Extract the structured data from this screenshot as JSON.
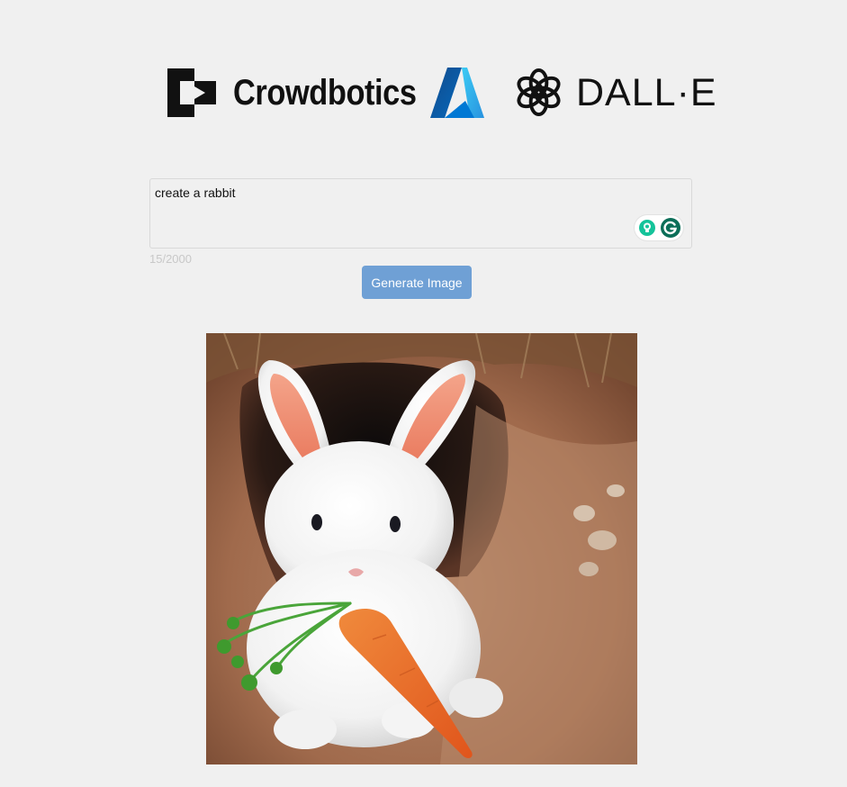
{
  "header": {
    "logos": [
      {
        "name": "crowdbotics-logo",
        "text": "Crowdbotics"
      },
      {
        "name": "azure-logo",
        "text": ""
      },
      {
        "name": "openai-logo",
        "text": "DALL·E"
      }
    ]
  },
  "prompt": {
    "value": "create a rabbit",
    "placeholder": "",
    "char_count": "15/2000"
  },
  "actions": {
    "generate_label": "Generate Image"
  },
  "result": {
    "alt": "Generated image"
  },
  "icons": {
    "grammarly_suggestion": "lightbulb-icon",
    "grammarly": "grammarly-icon"
  },
  "colors": {
    "background": "#f0f0f0",
    "button": "#6fa0d5",
    "grammarly_green": "#15c39a",
    "grammarly_dark": "#0b6e58"
  }
}
